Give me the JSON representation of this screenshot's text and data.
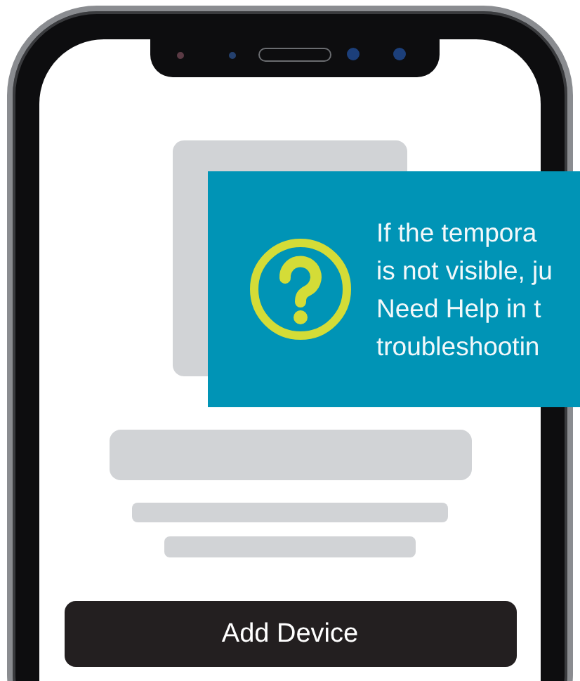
{
  "tooltip": {
    "lines": [
      "If the tempora",
      "is not visible, ju",
      "Need Help in t",
      "troubleshootin"
    ]
  },
  "button": {
    "label": "Add Device"
  }
}
